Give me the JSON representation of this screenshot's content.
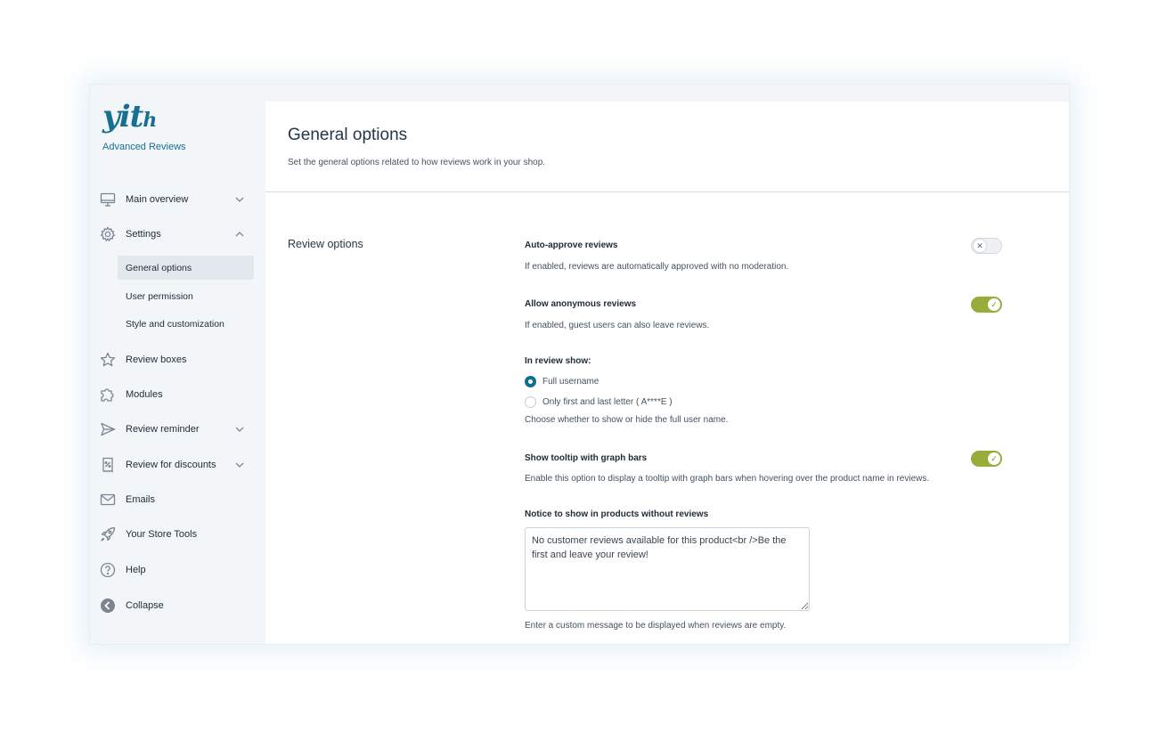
{
  "brand": {
    "logo_text": "yith",
    "plugin_name": "Advanced Reviews"
  },
  "sidebar": {
    "items": [
      {
        "label": "Main overview",
        "icon": "monitor-icon",
        "has_chevron": true,
        "chevron": "down"
      },
      {
        "label": "Settings",
        "icon": "gear-icon",
        "has_chevron": true,
        "chevron": "up"
      },
      {
        "label": "Review boxes",
        "icon": "star-icon"
      },
      {
        "label": "Modules",
        "icon": "puzzle-icon"
      },
      {
        "label": "Review reminder",
        "icon": "send-icon",
        "has_chevron": true,
        "chevron": "down"
      },
      {
        "label": "Review for discounts",
        "icon": "coupon-icon",
        "has_chevron": true,
        "chevron": "down"
      },
      {
        "label": "Emails",
        "icon": "envelope-icon"
      },
      {
        "label": "Your Store Tools",
        "icon": "rocket-icon"
      },
      {
        "label": "Help",
        "icon": "help-icon"
      },
      {
        "label": "Collapse",
        "icon": "collapse-icon"
      }
    ],
    "settings_sub": [
      {
        "label": "General options",
        "active": true
      },
      {
        "label": "User permission"
      },
      {
        "label": "Style and customization"
      }
    ]
  },
  "page": {
    "title": "General options",
    "description": "Set the general options related to how reviews work in your shop."
  },
  "section": {
    "title": "Review options"
  },
  "options": {
    "auto_approve": {
      "label": "Auto-approve reviews",
      "desc": "If enabled, reviews are automatically approved with no moderation.",
      "enabled": false
    },
    "anonymous": {
      "label": "Allow anonymous reviews",
      "desc": "If enabled, guest users can also leave reviews.",
      "enabled": true
    },
    "review_show": {
      "label": "In review show:",
      "choices": [
        {
          "label": "Full username",
          "checked": true
        },
        {
          "label": "Only first and last letter ( A****E )",
          "checked": false
        }
      ],
      "desc": "Choose whether to show or hide the full user name."
    },
    "tooltip": {
      "label": "Show tooltip with graph bars",
      "desc": "Enable this option to display a tooltip with graph bars when hovering over the product name in reviews.",
      "enabled": true
    },
    "notice": {
      "label": "Notice to show in products without reviews",
      "value": "No customer reviews available for this product<br />Be the first and leave your review!",
      "desc": "Enter a custom message to be displayed when reviews are empty."
    }
  },
  "colors": {
    "brand": "#176f91",
    "toggle_on": "#96ad3a",
    "radio_checked": "#0f6e8f"
  }
}
